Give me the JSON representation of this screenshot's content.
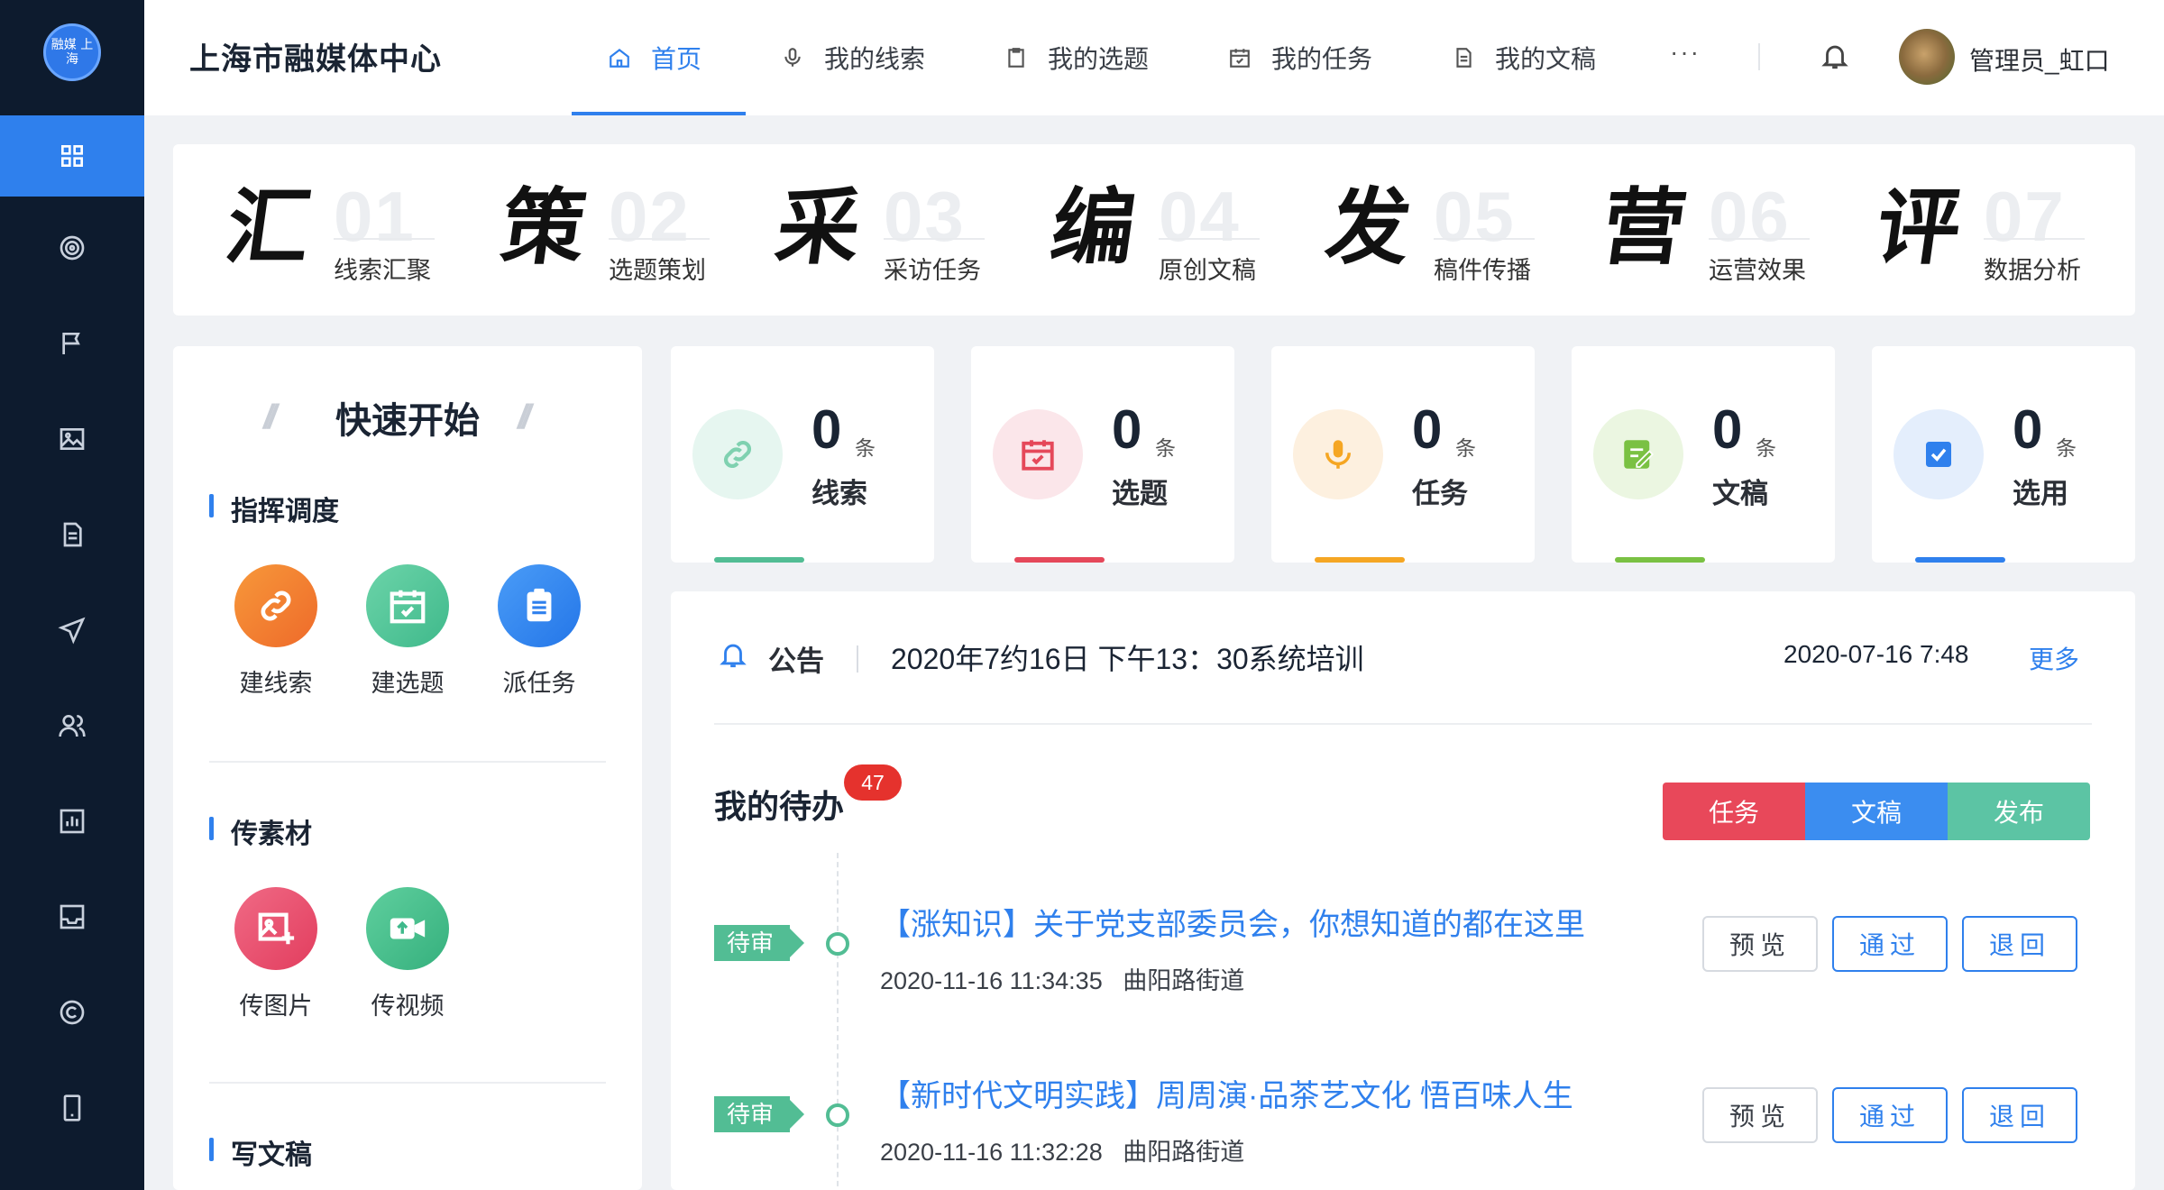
{
  "sidebar": {
    "logo_text": "融媒 上海",
    "items": [
      {
        "icon": "grid-icon",
        "active": true
      },
      {
        "icon": "target-icon"
      },
      {
        "icon": "flag-icon"
      },
      {
        "icon": "image-icon"
      },
      {
        "icon": "document-icon"
      },
      {
        "icon": "send-icon"
      },
      {
        "icon": "users-icon"
      },
      {
        "icon": "bar-chart-icon"
      },
      {
        "icon": "inbox-icon"
      },
      {
        "icon": "copyright-icon"
      },
      {
        "icon": "mobile-icon"
      }
    ]
  },
  "header": {
    "brand": "上海市融媒体中心",
    "nav": [
      {
        "label": "首页",
        "icon": "home-icon",
        "active": true
      },
      {
        "label": "我的线索",
        "icon": "microphone-icon"
      },
      {
        "label": "我的选题",
        "icon": "clipboard-icon"
      },
      {
        "label": "我的任务",
        "icon": "calendar-check-icon"
      },
      {
        "label": "我的文稿",
        "icon": "file-text-icon"
      }
    ],
    "more": "···",
    "user": "管理员_虹口"
  },
  "process": [
    {
      "glyph": "汇",
      "num": "01",
      "label": "线索汇聚"
    },
    {
      "glyph": "策",
      "num": "02",
      "label": "选题策划"
    },
    {
      "glyph": "采",
      "num": "03",
      "label": "采访任务"
    },
    {
      "glyph": "编",
      "num": "04",
      "label": "原创文稿"
    },
    {
      "glyph": "发",
      "num": "05",
      "label": "稿件传播"
    },
    {
      "glyph": "营",
      "num": "06",
      "label": "运营效果"
    },
    {
      "glyph": "评",
      "num": "07",
      "label": "数据分析"
    }
  ],
  "quick_start": {
    "title": "快速开始",
    "sections": [
      {
        "title": "指挥调度",
        "buttons": [
          "建线索",
          "建选题",
          "派任务"
        ]
      },
      {
        "title": "传素材",
        "buttons": [
          "传图片",
          "传视频"
        ]
      },
      {
        "title": "写文稿"
      }
    ]
  },
  "stats": [
    {
      "value": "0",
      "unit": "条",
      "label": "线索",
      "color": "#52bd94"
    },
    {
      "value": "0",
      "unit": "条",
      "label": "选题",
      "color": "#e5485a"
    },
    {
      "value": "0",
      "unit": "条",
      "label": "任务",
      "color": "#f5a623"
    },
    {
      "value": "0",
      "unit": "条",
      "label": "文稿",
      "color": "#7ac143"
    },
    {
      "value": "0",
      "unit": "条",
      "label": "选用",
      "color": "#2f80ed"
    }
  ],
  "announcement": {
    "label": "公告",
    "text": "2020年7约16日 下午13：30系统培训",
    "time": "2020-07-16 7:48",
    "more": "更多"
  },
  "todo": {
    "title": "我的待办",
    "badge": "47",
    "tabs": [
      {
        "label": "任务",
        "color": "#e8485a"
      },
      {
        "label": "文稿",
        "color": "#3b8df0"
      },
      {
        "label": "发布",
        "color": "#5cc4a4"
      }
    ],
    "items": [
      {
        "status": "待审",
        "title": "【涨知识】关于党支部委员会，你想知道的都在这里",
        "time": "2020-11-16 11:34:35",
        "dept": "曲阳路街道"
      },
      {
        "status": "待审",
        "title": "【新时代文明实践】周周演·品茶艺文化 悟百味人生",
        "time": "2020-11-16 11:32:28",
        "dept": "曲阳路街道"
      }
    ],
    "actions": {
      "preview": "预览",
      "pass": "通过",
      "back": "退回"
    }
  }
}
